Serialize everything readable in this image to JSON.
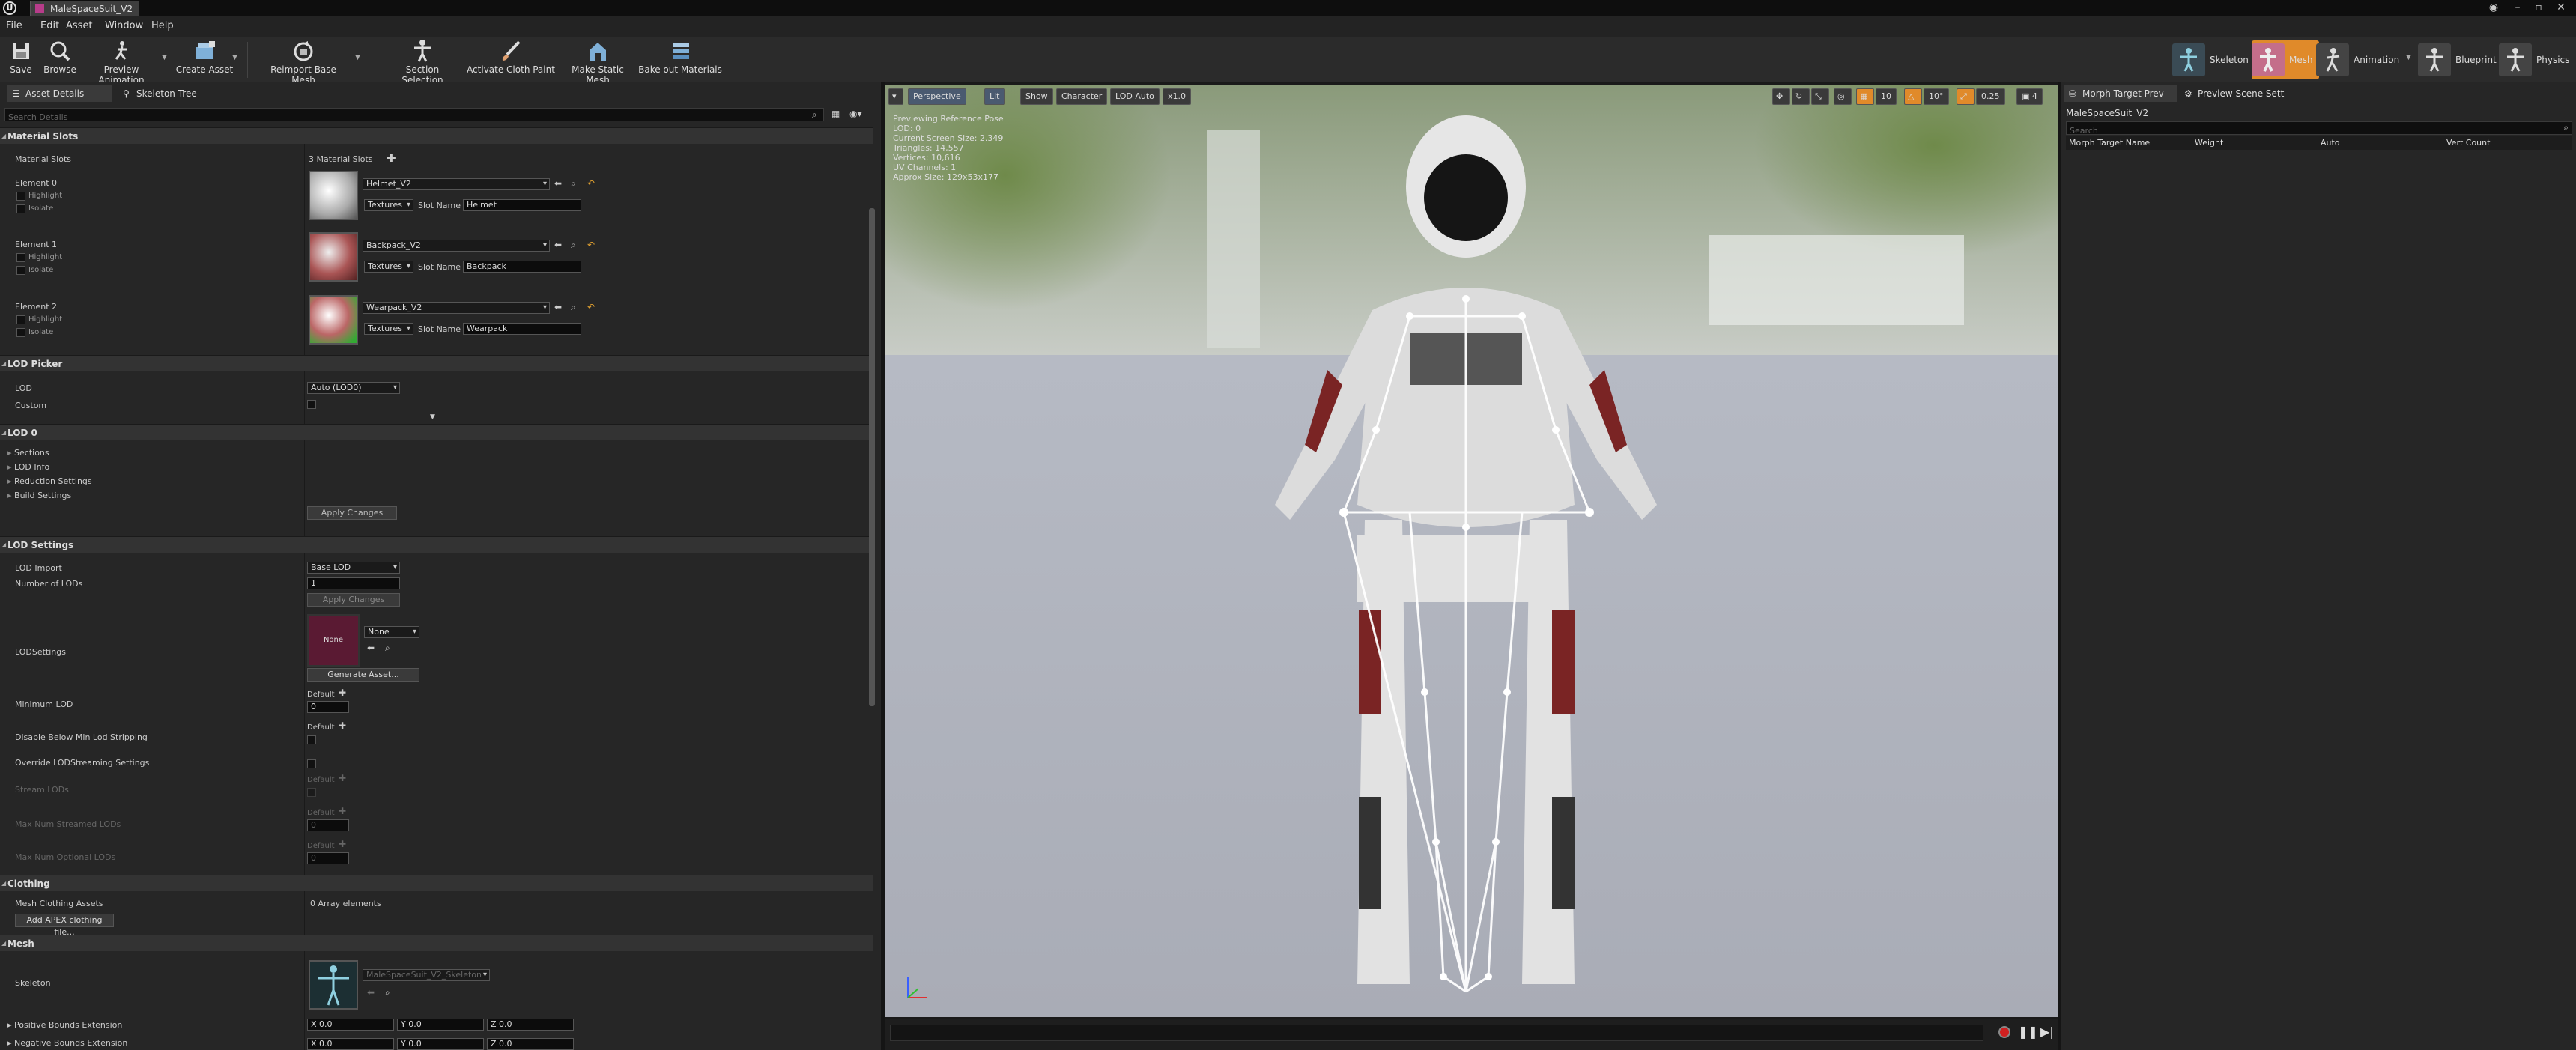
{
  "titlebar": {
    "tab": "MaleSpaceSuit_V2"
  },
  "menu": [
    "File",
    "Edit",
    "Asset",
    "Window",
    "Help"
  ],
  "toolbar": {
    "buttons": [
      "Save",
      "Browse",
      "Preview Animation",
      "Create Asset",
      "Reimport Base Mesh",
      "Section Selection",
      "Activate Cloth Paint",
      "Make Static Mesh",
      "Bake out Materials"
    ],
    "modes": [
      "Skeleton",
      "Mesh",
      "Animation",
      "Blueprint",
      "Physics"
    ]
  },
  "left_panel": {
    "tabs": [
      "Asset Details",
      "Skeleton Tree"
    ],
    "search_placeholder": "Search Details",
    "material_slots": {
      "header": "Material Slots",
      "label": "Material Slots",
      "count": "3 Material Slots",
      "elements": [
        {
          "label": "Element 0",
          "material": "Helmet_V2",
          "textures": "Textures",
          "slot_label": "Slot Name",
          "slot": "Helmet"
        },
        {
          "label": "Element 1",
          "material": "Backpack_V2",
          "textures": "Textures",
          "slot_label": "Slot Name",
          "slot": "Backpack"
        },
        {
          "label": "Element 2",
          "material": "Wearpack_V2",
          "textures": "Textures",
          "slot_label": "Slot Name",
          "slot": "Wearpack"
        }
      ],
      "highlight": "Highlight",
      "isolate": "Isolate"
    },
    "lod_picker": {
      "header": "LOD Picker",
      "lod_label": "LOD",
      "lod_value": "Auto (LOD0)",
      "custom_label": "Custom"
    },
    "lod0": {
      "header": "LOD 0",
      "items": [
        "Sections",
        "LOD Info",
        "Reduction Settings",
        "Build Settings"
      ],
      "apply": "Apply Changes"
    },
    "lod_settings": {
      "header": "LOD Settings",
      "lod_import": "LOD Import",
      "lod_import_value": "Base LOD",
      "num_lods": "Number of LODs",
      "num_lods_value": "1",
      "apply": "Apply Changes",
      "lodsettings": "LODSettings",
      "thumb_text": "None",
      "none_value": "None",
      "generate": "Generate Asset...",
      "min_lod": "Minimum LOD",
      "default": "Default",
      "min_lod_value": "0",
      "disable_below": "Disable Below Min Lod Stripping",
      "override": "Override LODStreaming Settings",
      "stream_lods": "Stream LODs",
      "max_streamed": "Max Num Streamed LODs",
      "max_streamed_value": "0",
      "max_optional": "Max Num Optional LODs",
      "max_optional_value": "0"
    },
    "clothing": {
      "header": "Clothing",
      "label": "Mesh Clothing Assets",
      "value": "0 Array elements",
      "add_button": "Add APEX clothing file..."
    },
    "mesh": {
      "header": "Mesh",
      "skeleton": "Skeleton",
      "skeleton_value": "MaleSpaceSuit_V2_Skeleton",
      "pos_bounds": "Positive Bounds Extension",
      "neg_bounds": "Negative Bounds Extension",
      "x": "X 0.0",
      "y": "Y 0.0",
      "z": "Z 0.0"
    }
  },
  "viewport": {
    "buttons": [
      "Perspective",
      "Lit",
      "Show",
      "Character",
      "LOD Auto",
      "x1.0"
    ],
    "right_values": [
      "10",
      "10°",
      "0.25",
      "4"
    ],
    "stats": [
      "Previewing Reference Pose",
      "LOD: 0",
      "Current Screen Size: 2.349",
      "Triangles: 14,557",
      "Vertices: 10,616",
      "UV Channels: 1",
      "Approx Size: 129x53x177"
    ]
  },
  "right_panel": {
    "tabs": [
      "Morph Target Prev",
      "Preview Scene Sett"
    ],
    "asset": "MaleSpaceSuit_V2",
    "search_placeholder": "Search",
    "columns": [
      "Morph Target Name",
      "Weight",
      "Auto",
      "Vert Count"
    ]
  },
  "colors": {
    "accent": "#e08a2a",
    "panel": "#262626",
    "viewport_bg": "#b9bcc4"
  }
}
